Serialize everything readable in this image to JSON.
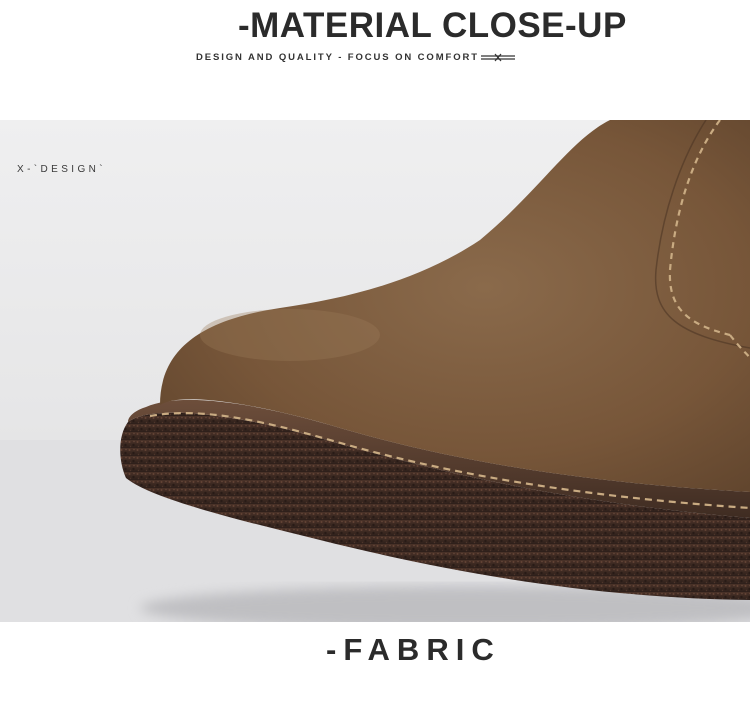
{
  "header": {
    "title": "-MATERIAL CLOSE-UP",
    "subtitle": "DESIGN AND QUALITY - FOCUS ON COMFORT"
  },
  "photo": {
    "tag": "X-`DESIGN`",
    "subject": "boot-toe-suede-closeup"
  },
  "caption": {
    "label": "-FABRIC"
  },
  "colors": {
    "text": "#2b2b2b",
    "background": "#eaeaeb",
    "suede": "#7a5a3c",
    "sole": "#3e2a22",
    "stitch": "#c9ab82"
  }
}
